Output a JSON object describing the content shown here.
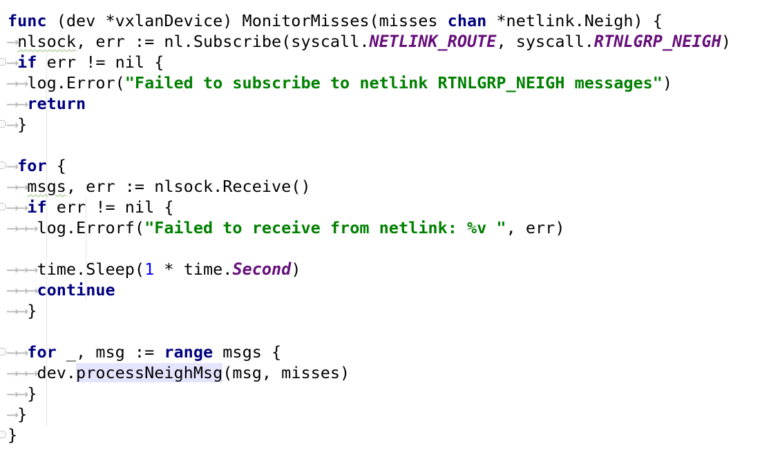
{
  "code": {
    "line1": {
      "kw_func": "func",
      "sig": " (dev *vxlanDevice) MonitorMisses(misses ",
      "kw_chan": "chan",
      "rest": " *netlink.Neigh) {"
    },
    "line2": {
      "var": "nlsock",
      "mid": ", err := nl.Subscribe(syscall.",
      "c1": "NETLINK_ROUTE",
      "mid2": ", syscall.",
      "c2": "RTNLGRP_NEIGH",
      "end": ")"
    },
    "line3": {
      "kw": "if",
      "rest": " err != nil {"
    },
    "line4": {
      "call": "log.Error(",
      "str": "\"Failed to subscribe to netlink RTNLGRP_NEIGH messages\"",
      "end": ")"
    },
    "line5": {
      "kw": "return"
    },
    "line6": {
      "brace": "}"
    },
    "line8": {
      "kw": "for",
      "rest": " {"
    },
    "line9": {
      "var": "msgs",
      "rest": ", err := nlsock.Receive()"
    },
    "line10": {
      "kw": "if",
      "rest": " err != nil {"
    },
    "line11": {
      "call": "log.Errorf(",
      "str": "\"Failed to receive from netlink: %v \"",
      "end": ", err)"
    },
    "line13": {
      "call": "time.Sleep(",
      "num": "1",
      "mid": " * time.",
      "const": "Second",
      "end": ")"
    },
    "line14": {
      "kw": "continue"
    },
    "line15": {
      "brace": "}"
    },
    "line17": {
      "kw": "for",
      "mid": " _, msg := ",
      "kw2": "range",
      "rest": " msgs {"
    },
    "line18": {
      "pre": "dev.",
      "method": "processNeighMsg",
      "rest": "(msg, misses)"
    },
    "line19": {
      "brace": "}"
    },
    "line20": {
      "brace": "}"
    },
    "line21": {
      "brace": "}"
    }
  }
}
